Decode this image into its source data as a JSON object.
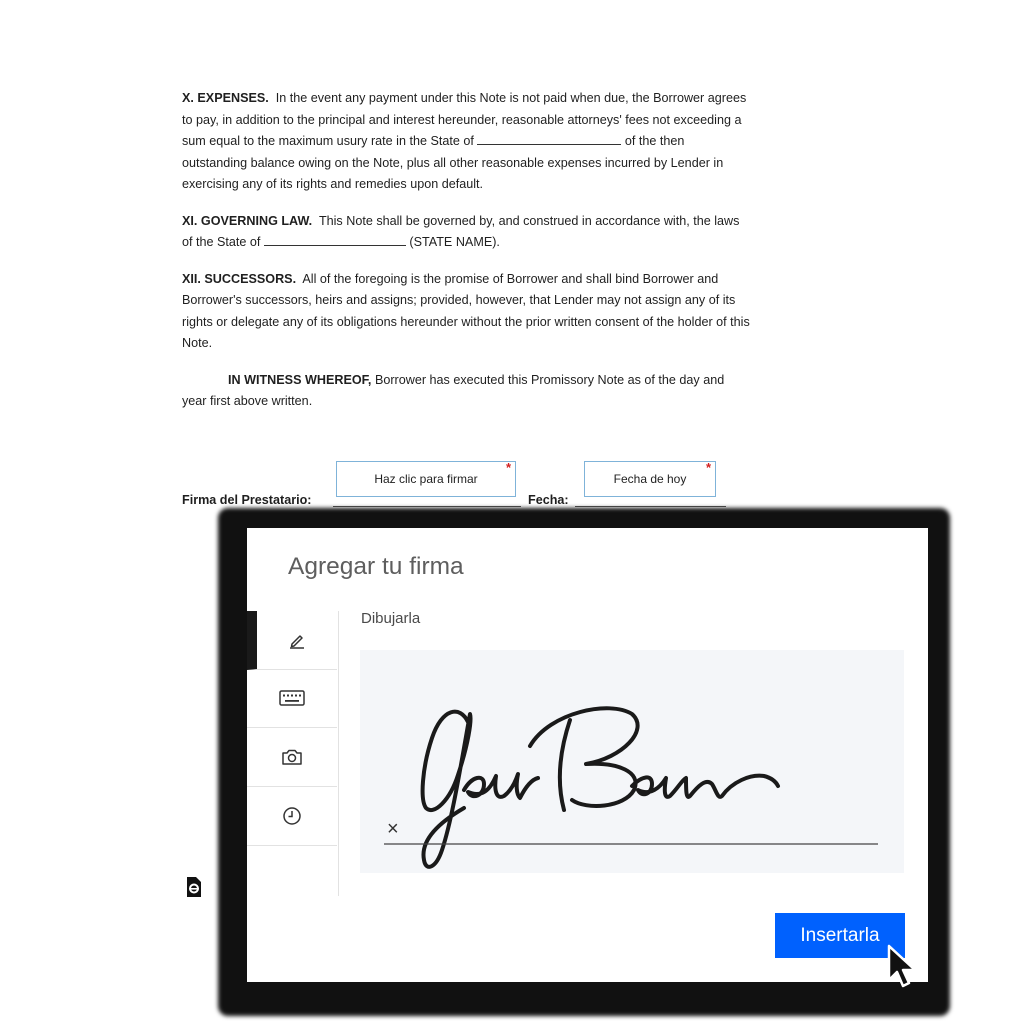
{
  "document": {
    "sec10": {
      "heading": "X. EXPENSES.",
      "text_a": "In the event any payment under this Note is not paid when due, the Borrower agrees to pay, in addition to the principal and interest hereunder, reasonable attorneys' fees not exceeding a sum equal to the maximum usury rate in the State of",
      "text_b": "of the then outstanding balance owing on the Note, plus all other reasonable expenses incurred by Lender in exercising any of its rights and remedies upon default."
    },
    "sec11": {
      "heading": "XI. GOVERNING LAW.",
      "text_a": "This Note shall be governed by, and construed in accordance with, the laws of the State of",
      "text_b": "(STATE NAME)."
    },
    "sec12": {
      "heading": "XII. SUCCESSORS.",
      "text": "All of the foregoing is the promise of Borrower and shall bind Borrower and Borrower's successors, heirs and assigns; provided, however, that Lender may not assign any of its rights or delegate any of its obligations hereunder without the prior written consent of the holder of this Note."
    },
    "witness": {
      "heading": "IN WITNESS WHEREOF,",
      "text": "Borrower has executed this Promissory Note as of the day and year first above written."
    },
    "signature_line": {
      "borrower_label": "Firma del Prestatario:",
      "date_label": "Fecha:",
      "sign_field": "Haz clic para firmar",
      "date_field": "Fecha de hoy",
      "required_mark": "*"
    }
  },
  "dialog": {
    "title": "Agregar tu firma",
    "mode_label": "Dibujarla",
    "clear_mark": "×",
    "tabs": [
      "pen-icon",
      "keyboard-icon",
      "camera-icon",
      "clock-icon"
    ],
    "insert_label": "Insertarla",
    "accent": "#0061fe"
  }
}
